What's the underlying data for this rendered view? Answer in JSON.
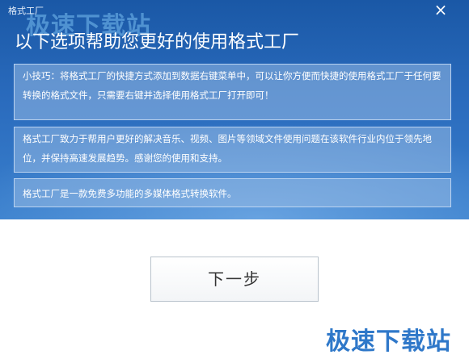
{
  "window": {
    "title": "格式工厂",
    "close_icon": "close-icon"
  },
  "watermark": "极速下载站",
  "header": {
    "title": "以下选项帮助您更好的使用格式工厂"
  },
  "tips": [
    {
      "text": "小技巧：将格式工厂的快捷方式添加到数据右键菜单中，可以让你方便而快捷的使用格式工厂于任何要转换的格式文件，只需要右键并选择使用格式工厂打开即可！"
    },
    {
      "text": "格式工厂致力于帮用户更好的解决音乐、视频、图片等领域文件使用问题在该软件行业内位于领先地位，并保持高速发展趋势。感谢您的使用和支持。"
    },
    {
      "text": "格式工厂是一款免费多功能的多媒体格式转换软件。"
    }
  ],
  "buttons": {
    "next_label": "下一步"
  }
}
